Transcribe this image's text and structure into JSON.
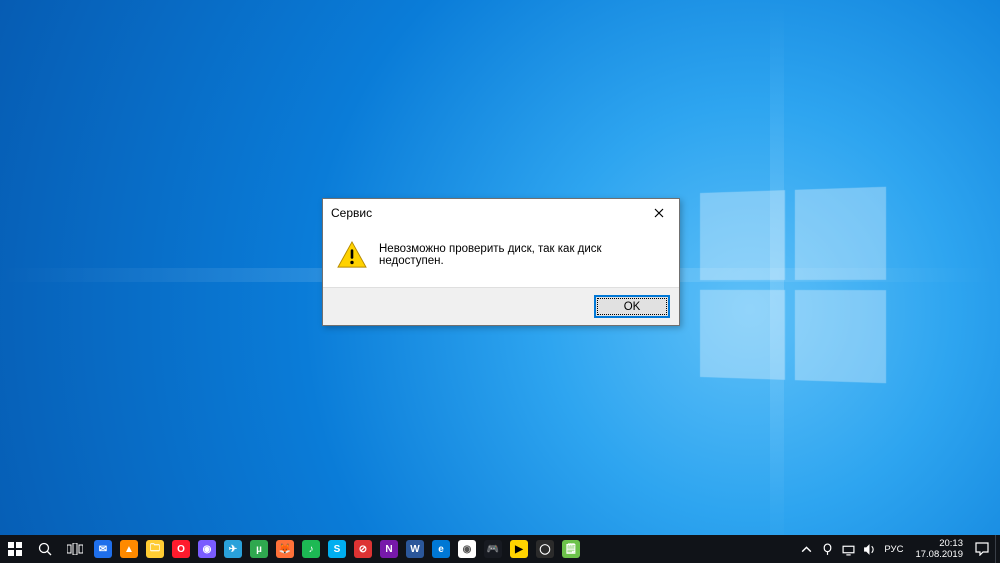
{
  "dialog": {
    "title": "Сервис",
    "message": "Невозможно проверить диск, так как диск недоступен.",
    "ok_label": "OK"
  },
  "taskbar": {
    "apps": [
      {
        "name": "start",
        "icon": "win"
      },
      {
        "name": "search",
        "icon": "search"
      },
      {
        "name": "task-view",
        "icon": "taskview"
      },
      {
        "name": "thunderbird",
        "bg": "#1f6feb",
        "glyph": "✉"
      },
      {
        "name": "vlc",
        "bg": "#ff8a00",
        "glyph": "▲"
      },
      {
        "name": "explorer",
        "bg": "#ffcc33",
        "glyph": "🗀"
      },
      {
        "name": "opera",
        "bg": "#ff1b2d",
        "glyph": "O"
      },
      {
        "name": "disc",
        "bg": "#7a5cff",
        "glyph": "◉"
      },
      {
        "name": "telegram",
        "bg": "#2aa1da",
        "glyph": "✈"
      },
      {
        "name": "torrent",
        "bg": "#2fa84f",
        "glyph": "µ"
      },
      {
        "name": "firefox",
        "bg": "#ff7139",
        "glyph": "🦊"
      },
      {
        "name": "spotify",
        "bg": "#1db954",
        "glyph": "♪"
      },
      {
        "name": "skype",
        "bg": "#00aff0",
        "glyph": "S"
      },
      {
        "name": "not-disturb",
        "bg": "#d33",
        "glyph": "⊘"
      },
      {
        "name": "onenote",
        "bg": "#7719aa",
        "glyph": "N"
      },
      {
        "name": "word",
        "bg": "#2b579a",
        "glyph": "W"
      },
      {
        "name": "edge",
        "bg": "#0078d4",
        "glyph": "e"
      },
      {
        "name": "chrome",
        "bg": "#fff",
        "glyph": "◉",
        "fg": "#555"
      },
      {
        "name": "steam",
        "bg": "#171a21",
        "glyph": "🎮"
      },
      {
        "name": "potplayer",
        "bg": "#ffd400",
        "glyph": "▶",
        "fg": "#000"
      },
      {
        "name": "obs",
        "bg": "#2b2b2b",
        "glyph": "◯"
      },
      {
        "name": "notepad",
        "bg": "#6cc24a",
        "glyph": "🗒"
      }
    ],
    "tray": {
      "lang": "РУС",
      "time": "20:13",
      "date": "17.08.2019"
    }
  }
}
